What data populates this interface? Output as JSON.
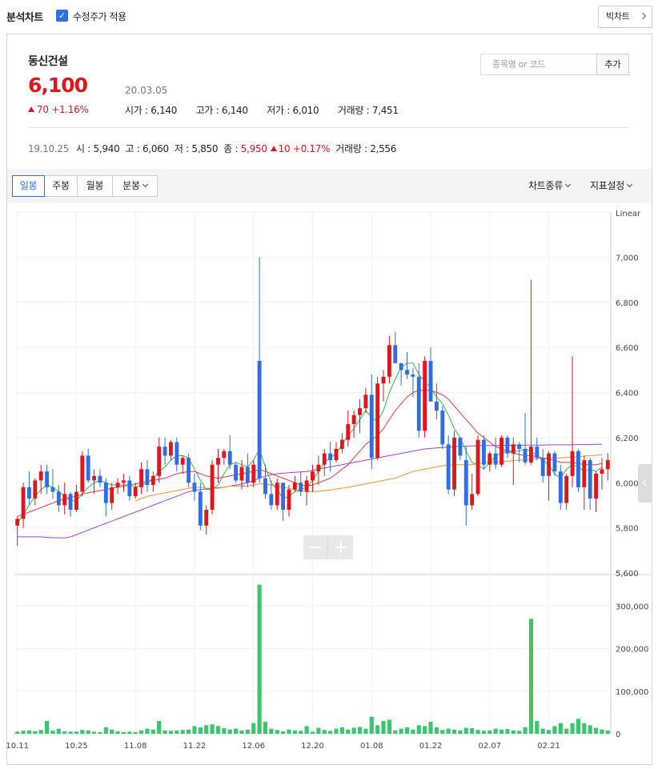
{
  "header": {
    "title": "분석차트",
    "adjusted_price_label": "수정주가 적용",
    "adjusted_price_checked": true,
    "big_chart_label": "빅차트"
  },
  "stock": {
    "name": "동신건설",
    "price": "6,100",
    "change": "70",
    "change_pct": "+1.16%",
    "date": "20.03.05",
    "open": "시가 : 6,140",
    "high": "고가 : 6,140",
    "low": "저가 : 6,010",
    "volume": "거래량 : 7,451"
  },
  "search": {
    "placeholder": "종목명 or 코드",
    "add_label": "추가"
  },
  "hover_row": {
    "date": "19.10.25",
    "open": "시 : 5,940",
    "high": "고 : 6,060",
    "low": "저 : 5,850",
    "close_label": "종 : ",
    "close": "5,950",
    "change": "10",
    "change_pct": "+0.17%",
    "volume": "거래량 : 2,556"
  },
  "toolbar": {
    "tabs": [
      "일봉",
      "주봉",
      "월봉",
      "분봉"
    ],
    "active_tab": 0,
    "chart_type_label": "차트종류",
    "indicator_label": "지표설정"
  },
  "colors": {
    "up": "#e0151e",
    "down": "#2f6de1",
    "volume": "#3cc46e",
    "ma5": "#34b44a",
    "ma20": "#e23b3b",
    "ma60": "#f0902f",
    "ma120": "#a046d8"
  },
  "chart_data": {
    "type": "candlestick",
    "scale_label": "Linear",
    "price_ticks": [
      "7,000",
      "6,800",
      "6,600",
      "6,400",
      "6,200",
      "6,000",
      "5,800",
      "5,600"
    ],
    "price_tick_values": [
      7000,
      6800,
      6600,
      6400,
      6200,
      6000,
      5800,
      5600
    ],
    "ylim": [
      5600,
      7200
    ],
    "volume_ticks": [
      "300,000",
      "200,000",
      "100,000",
      "0"
    ],
    "volume_tick_values": [
      300000,
      200000,
      100000,
      0
    ],
    "volume_ylim": [
      0,
      370000
    ],
    "date_labels": [
      {
        "label": "10.11",
        "index": 0
      },
      {
        "label": "10.25",
        "index": 10
      },
      {
        "label": "11.08",
        "index": 20
      },
      {
        "label": "11.22",
        "index": 30
      },
      {
        "label": "12.06",
        "index": 40
      },
      {
        "label": "12.20",
        "index": 50
      },
      {
        "label": "01.08",
        "index": 60
      },
      {
        "label": "01.22",
        "index": 70
      },
      {
        "label": "02.07",
        "index": 80
      },
      {
        "label": "02.21",
        "index": 90
      }
    ],
    "candles": [
      [
        5810,
        5850,
        5720,
        5840,
        5000
      ],
      [
        5840,
        6000,
        5800,
        5980,
        7000
      ],
      [
        5980,
        6050,
        5900,
        5930,
        8000
      ],
      [
        5930,
        6020,
        5900,
        6010,
        6000
      ],
      [
        6010,
        6080,
        5950,
        6050,
        9000
      ],
      [
        6050,
        6080,
        5950,
        5980,
        30000
      ],
      [
        5980,
        6060,
        5930,
        5960,
        7000
      ],
      [
        5960,
        5990,
        5870,
        5900,
        12000
      ],
      [
        5900,
        6000,
        5860,
        5950,
        6000
      ],
      [
        5950,
        5960,
        5850,
        5880,
        5000
      ],
      [
        5880,
        5990,
        5870,
        5960,
        5000
      ],
      [
        5960,
        6140,
        5940,
        6120,
        9000
      ],
      [
        6120,
        6150,
        6000,
        6010,
        8000
      ],
      [
        6010,
        6060,
        5950,
        6030,
        5000
      ],
      [
        6030,
        6060,
        5980,
        6000,
        4000
      ],
      [
        6000,
        6020,
        5850,
        5910,
        15000
      ],
      [
        5910,
        6000,
        5880,
        5980,
        10000
      ],
      [
        5980,
        6020,
        5950,
        6000,
        6000
      ],
      [
        6000,
        6040,
        5960,
        6010,
        4000
      ],
      [
        6010,
        6030,
        5920,
        5940,
        5000
      ],
      [
        5940,
        6000,
        5930,
        5980,
        4000
      ],
      [
        5980,
        6090,
        5950,
        6060,
        8000
      ],
      [
        6060,
        6100,
        5960,
        5990,
        12000
      ],
      [
        5990,
        6050,
        5960,
        6030,
        10000
      ],
      [
        6030,
        6200,
        6000,
        6160,
        30000
      ],
      [
        6160,
        6200,
        6080,
        6120,
        8000
      ],
      [
        6120,
        6190,
        6100,
        6180,
        7000
      ],
      [
        6180,
        6200,
        6050,
        6080,
        8000
      ],
      [
        6080,
        6120,
        6040,
        6110,
        9000
      ],
      [
        6110,
        6130,
        5980,
        6000,
        10000
      ],
      [
        6000,
        6040,
        5920,
        5960,
        18000
      ],
      [
        5960,
        6000,
        5790,
        5810,
        15000
      ],
      [
        5810,
        5900,
        5770,
        5880,
        20000
      ],
      [
        5880,
        6100,
        5860,
        6080,
        22000
      ],
      [
        6080,
        6150,
        6000,
        6110,
        18000
      ],
      [
        6110,
        6150,
        6080,
        6140,
        13000
      ],
      [
        6140,
        6210,
        6060,
        6080,
        10000
      ],
      [
        6080,
        6090,
        6000,
        6010,
        12000
      ],
      [
        6010,
        6100,
        5970,
        6070,
        8000
      ],
      [
        6070,
        6130,
        5980,
        6000,
        10000
      ],
      [
        6000,
        6100,
        5980,
        6080,
        25000
      ],
      [
        6540,
        7000,
        6000,
        6020,
        350000
      ],
      [
        6020,
        6080,
        5930,
        5950,
        28000
      ],
      [
        5950,
        6010,
        5880,
        5900,
        12000
      ],
      [
        5900,
        6020,
        5880,
        6000,
        9000
      ],
      [
        6000,
        6000,
        5830,
        5880,
        6000
      ],
      [
        5880,
        5990,
        5850,
        5970,
        10000
      ],
      [
        5970,
        6030,
        5960,
        6000,
        8000
      ],
      [
        6000,
        6050,
        5940,
        5960,
        7000
      ],
      [
        5960,
        6030,
        5900,
        6010,
        18000
      ],
      [
        6010,
        6080,
        5960,
        6050,
        5000
      ],
      [
        6050,
        6120,
        5990,
        6080,
        14000
      ],
      [
        6080,
        6150,
        6030,
        6130,
        9000
      ],
      [
        6130,
        6180,
        6050,
        6100,
        7000
      ],
      [
        6100,
        6180,
        6090,
        6150,
        12000
      ],
      [
        6150,
        6220,
        6130,
        6190,
        15000
      ],
      [
        6190,
        6320,
        6160,
        6260,
        10000
      ],
      [
        6260,
        6320,
        6200,
        6300,
        14000
      ],
      [
        6300,
        6370,
        6220,
        6330,
        16000
      ],
      [
        6330,
        6420,
        6310,
        6390,
        12000
      ],
      [
        6390,
        6480,
        6060,
        6110,
        40000
      ],
      [
        6110,
        6470,
        6100,
        6440,
        20000
      ],
      [
        6440,
        6500,
        6360,
        6470,
        30000
      ],
      [
        6470,
        6650,
        6440,
        6610,
        33000
      ],
      [
        6610,
        6670,
        6540,
        6530,
        8000
      ],
      [
        6530,
        6530,
        6430,
        6500,
        12000
      ],
      [
        6500,
        6580,
        6460,
        6480,
        15000
      ],
      [
        6480,
        6510,
        6380,
        6470,
        10000
      ],
      [
        6470,
        6530,
        6200,
        6230,
        20000
      ],
      [
        6230,
        6560,
        6200,
        6540,
        18000
      ],
      [
        6540,
        6600,
        6380,
        6360,
        28000
      ],
      [
        6360,
        6440,
        6280,
        6320,
        15000
      ],
      [
        6320,
        6340,
        6150,
        6170,
        9000
      ],
      [
        6170,
        6210,
        5950,
        5970,
        12000
      ],
      [
        5970,
        6230,
        5940,
        6200,
        10000
      ],
      [
        6200,
        6200,
        6100,
        6120,
        8000
      ],
      [
        6100,
        6160,
        5810,
        5900,
        14000
      ],
      [
        5900,
        6040,
        5880,
        5950,
        13000
      ],
      [
        5950,
        6210,
        5940,
        6190,
        9000
      ],
      [
        6190,
        6210,
        6060,
        6080,
        7000
      ],
      [
        6080,
        6140,
        6050,
        6130,
        8000
      ],
      [
        6130,
        6200,
        6060,
        6080,
        12000
      ],
      [
        6080,
        6210,
        6070,
        6200,
        10000
      ],
      [
        6200,
        6210,
        6110,
        6130,
        11000
      ],
      [
        6130,
        6200,
        5990,
        6170,
        8000
      ],
      [
        6170,
        6180,
        6090,
        6150,
        7000
      ],
      [
        6150,
        6310,
        6080,
        6090,
        15000
      ],
      [
        6090,
        6900,
        6080,
        6160,
        270000
      ],
      [
        6160,
        6200,
        6100,
        6110,
        30000
      ],
      [
        6110,
        6150,
        6000,
        6030,
        12000
      ],
      [
        6030,
        6140,
        5920,
        6130,
        9000
      ],
      [
        6130,
        6140,
        6030,
        6050,
        18000
      ],
      [
        6050,
        6080,
        5880,
        5910,
        25000
      ],
      [
        5910,
        6040,
        5880,
        6030,
        12000
      ],
      [
        6030,
        6560,
        5980,
        6140,
        25000
      ],
      [
        6140,
        6150,
        5960,
        5980,
        35000
      ],
      [
        5980,
        6120,
        5880,
        6100,
        25000
      ],
      [
        6100,
        6110,
        5880,
        5930,
        20000
      ],
      [
        5930,
        6050,
        5870,
        6040,
        14000
      ],
      [
        6040,
        6110,
        5970,
        6060,
        10000
      ],
      [
        6060,
        6130,
        6010,
        6100,
        7451
      ]
    ],
    "ma": {
      "ma5": [
        5820,
        5860,
        5900,
        5940,
        5970,
        5990,
        5980,
        5960,
        5940,
        5920,
        5920,
        5950,
        5980,
        6000,
        6010,
        6000,
        5990,
        5990,
        5990,
        5990,
        5980,
        5990,
        6000,
        6020,
        6050,
        6070,
        6100,
        6120,
        6120,
        6110,
        6060,
        6010,
        5970,
        5970,
        5990,
        6040,
        6080,
        6090,
        6080,
        6070,
        6100,
        6150,
        6070,
        6000,
        5970,
        5930,
        5940,
        5960,
        5970,
        5980,
        6010,
        6050,
        6090,
        6110,
        6130,
        6170,
        6210,
        6240,
        6280,
        6320,
        6290,
        6270,
        6320,
        6400,
        6460,
        6510,
        6530,
        6530,
        6480,
        6450,
        6420,
        6380,
        6350,
        6300,
        6240,
        6200,
        6140,
        6090,
        6080,
        6060,
        6090,
        6120,
        6130,
        6140,
        6140,
        6140,
        6150,
        6140,
        6120,
        6100,
        6080,
        6040,
        6020,
        6060,
        6080,
        6070,
        6050,
        6060,
        6050,
        6070
      ],
      "ma20": [
        5850,
        5860,
        5870,
        5880,
        5890,
        5900,
        5910,
        5920,
        5930,
        5935,
        5940,
        5950,
        5955,
        5960,
        5965,
        5970,
        5975,
        5980,
        5985,
        5990,
        5995,
        6000,
        6005,
        6010,
        6015,
        6020,
        6030,
        6040,
        6045,
        6050,
        6050,
        6040,
        6030,
        6025,
        6020,
        6025,
        6030,
        6035,
        6040,
        6045,
        6050,
        6060,
        6050,
        6040,
        6030,
        6020,
        6010,
        6000,
        5990,
        5985,
        5990,
        6000,
        6010,
        6020,
        6040,
        6060,
        6080,
        6110,
        6140,
        6170,
        6190,
        6210,
        6240,
        6280,
        6320,
        6350,
        6380,
        6400,
        6410,
        6410,
        6410,
        6400,
        6390,
        6370,
        6340,
        6310,
        6280,
        6250,
        6220,
        6200,
        6180,
        6160,
        6150,
        6140,
        6130,
        6125,
        6120,
        6120,
        6115,
        6110,
        6105,
        6100,
        6090,
        6090,
        6090,
        6085,
        6080,
        6080,
        6080,
        6085
      ],
      "ma60": [
        null,
        null,
        null,
        null,
        null,
        null,
        null,
        null,
        null,
        null,
        null,
        null,
        null,
        null,
        null,
        null,
        null,
        null,
        null,
        null,
        5920,
        5930,
        5940,
        5945,
        5950,
        5955,
        5960,
        5965,
        5970,
        5975,
        5980,
        5980,
        5975,
        5975,
        5975,
        5980,
        5985,
        5985,
        5985,
        5985,
        5990,
        5995,
        5995,
        5990,
        5985,
        5980,
        5975,
        5970,
        5965,
        5960,
        5960,
        5962,
        5965,
        5968,
        5972,
        5976,
        5980,
        5985,
        5990,
        5995,
        6000,
        6005,
        6010,
        6015,
        6020,
        6030,
        6040,
        6050,
        6055,
        6060,
        6065,
        6070,
        6075,
        6078,
        6080,
        6080,
        6080,
        6080,
        6085,
        6088,
        6090,
        6092,
        6094,
        6096,
        6098,
        6100,
        6102,
        6104,
        6106,
        6108,
        6110,
        6110,
        6110,
        6112,
        6114,
        6116,
        6118,
        6120,
        6122,
        6124
      ],
      "ma120": [
        5760,
        5760,
        5760,
        5760,
        5760,
        5758,
        5756,
        5756,
        5755,
        5760,
        5770,
        5780,
        5790,
        5800,
        5810,
        5820,
        5830,
        5840,
        5850,
        5860,
        5870,
        5880,
        5890,
        5900,
        5910,
        5920,
        5930,
        5940,
        5950,
        5960,
        5965,
        5970,
        5972,
        5975,
        5978,
        5980,
        5985,
        5990,
        5995,
        6000,
        6010,
        6020,
        6030,
        6035,
        6040,
        6042,
        6044,
        6046,
        6048,
        6050,
        6055,
        6060,
        6065,
        6070,
        6075,
        6080,
        6085,
        6090,
        6095,
        6100,
        6105,
        6110,
        6115,
        6120,
        6125,
        6130,
        6135,
        6140,
        6145,
        6150,
        6152,
        6154,
        6156,
        6158,
        6160,
        6161,
        6162,
        6163,
        6164,
        6165,
        6165,
        6165,
        6166,
        6166,
        6166,
        6166,
        6167,
        6167,
        6167,
        6167,
        6168,
        6168,
        6168,
        6168,
        6168,
        6169,
        6169,
        6169,
        6170,
        6170
      ]
    }
  }
}
